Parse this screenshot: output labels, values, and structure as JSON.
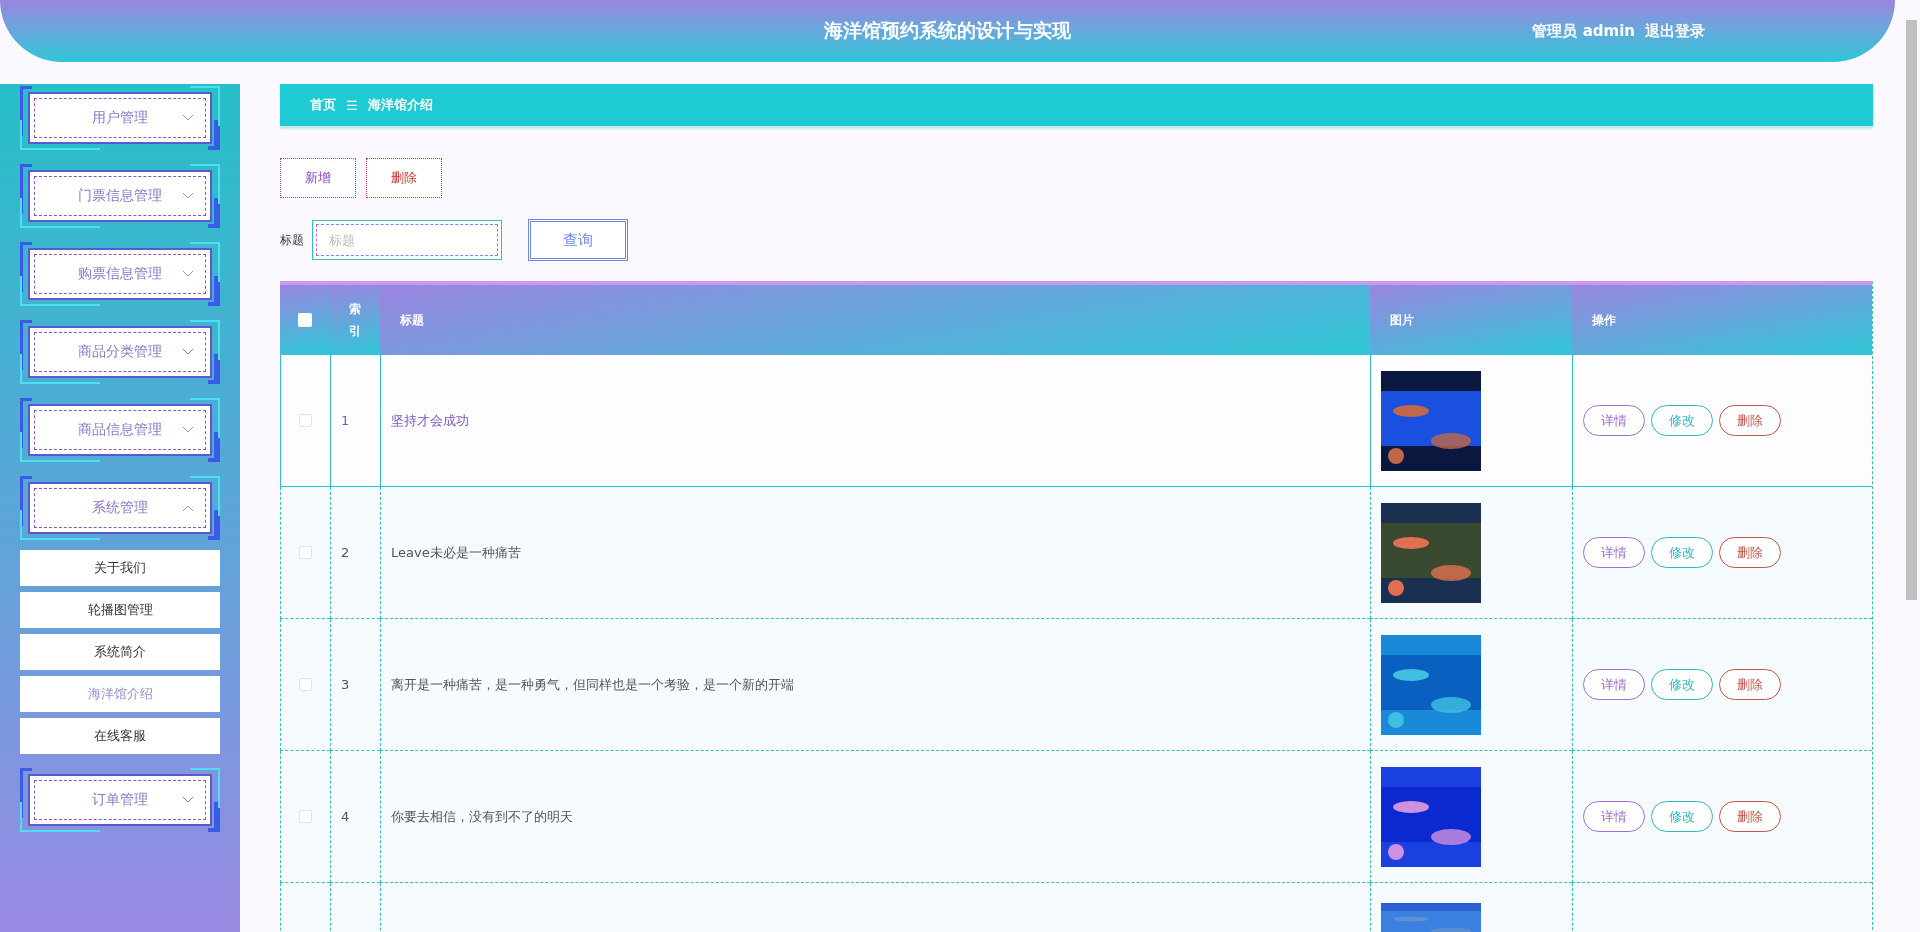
{
  "header": {
    "title": "海洋馆预约系统的设计与实现",
    "user": "管理员 admin",
    "logout": "退出登录"
  },
  "sidebar": {
    "items": [
      {
        "label": "用户管理",
        "expanded": false
      },
      {
        "label": "门票信息管理",
        "expanded": false
      },
      {
        "label": "购票信息管理",
        "expanded": false
      },
      {
        "label": "商品分类管理",
        "expanded": false
      },
      {
        "label": "商品信息管理",
        "expanded": false
      },
      {
        "label": "系统管理",
        "expanded": true,
        "children": [
          {
            "label": "关于我们",
            "selected": false
          },
          {
            "label": "轮播图管理",
            "selected": false
          },
          {
            "label": "系统简介",
            "selected": false
          },
          {
            "label": "海洋馆介绍",
            "selected": true
          },
          {
            "label": "在线客服",
            "selected": false
          }
        ]
      },
      {
        "label": "订单管理",
        "expanded": false
      }
    ]
  },
  "breadcrumb": {
    "home": "首页",
    "separator": "☰",
    "current": "海洋馆介绍"
  },
  "actions": {
    "add": "新增",
    "delete": "删除"
  },
  "search": {
    "label": "标题",
    "placeholder": "标题",
    "button": "查询"
  },
  "table": {
    "select_all_checked": false,
    "columns": [
      "索引",
      "标题",
      "图片",
      "操作"
    ],
    "rows": [
      {
        "index": "1",
        "title": "坚持才会成功",
        "checked": false,
        "selected": true,
        "actions": [
          "详情",
          "修改",
          "删除"
        ]
      },
      {
        "index": "2",
        "title": "Leave未必是一种痛苦",
        "checked": false,
        "selected": false,
        "actions": [
          "详情",
          "修改",
          "删除"
        ]
      },
      {
        "index": "3",
        "title": "离开是一种痛苦，是一种勇气，但同样也是一个考验，是一个新的开端",
        "checked": false,
        "selected": false,
        "actions": [
          "详情",
          "修改",
          "删除"
        ]
      },
      {
        "index": "4",
        "title": "你要去相信，没有到不了的明天",
        "checked": false,
        "selected": false,
        "actions": [
          "详情",
          "修改",
          "删除"
        ]
      },
      {
        "kind": "partial"
      }
    ]
  }
}
